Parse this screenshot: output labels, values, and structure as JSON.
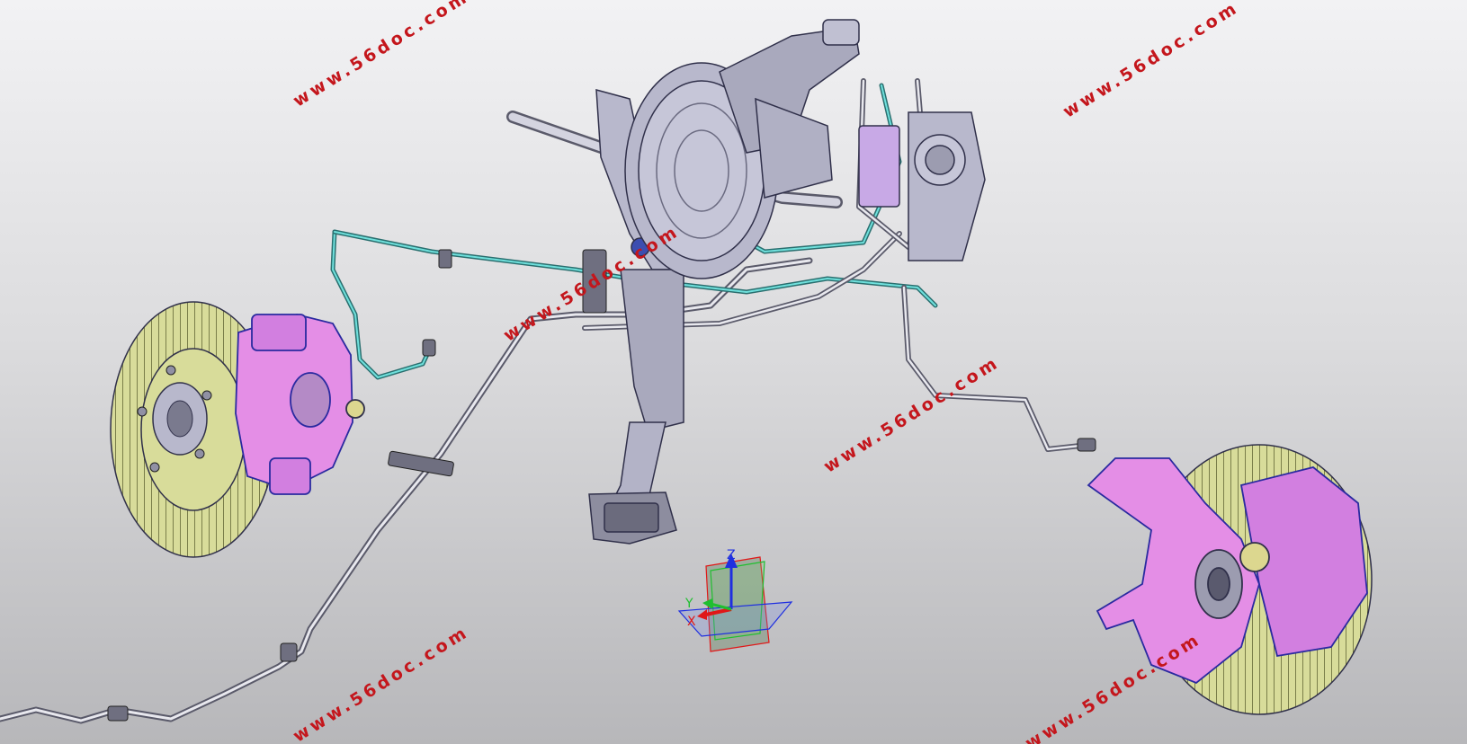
{
  "watermark": {
    "text": "www.56doc.com",
    "color": "#c4161c"
  },
  "compass": {
    "x_label": "X",
    "y_label": "Y",
    "z_label": "Z",
    "x_color": "#e01818",
    "y_color": "#1fbf2f",
    "z_color": "#1f2fe0"
  },
  "parts": {
    "disc_color": "#d8dc9a",
    "caliper_color": "#e48ee6",
    "assembly_color": "#b8b8cc",
    "brake_line_color": "#2fa8a8",
    "edge_color": "#30304a"
  }
}
